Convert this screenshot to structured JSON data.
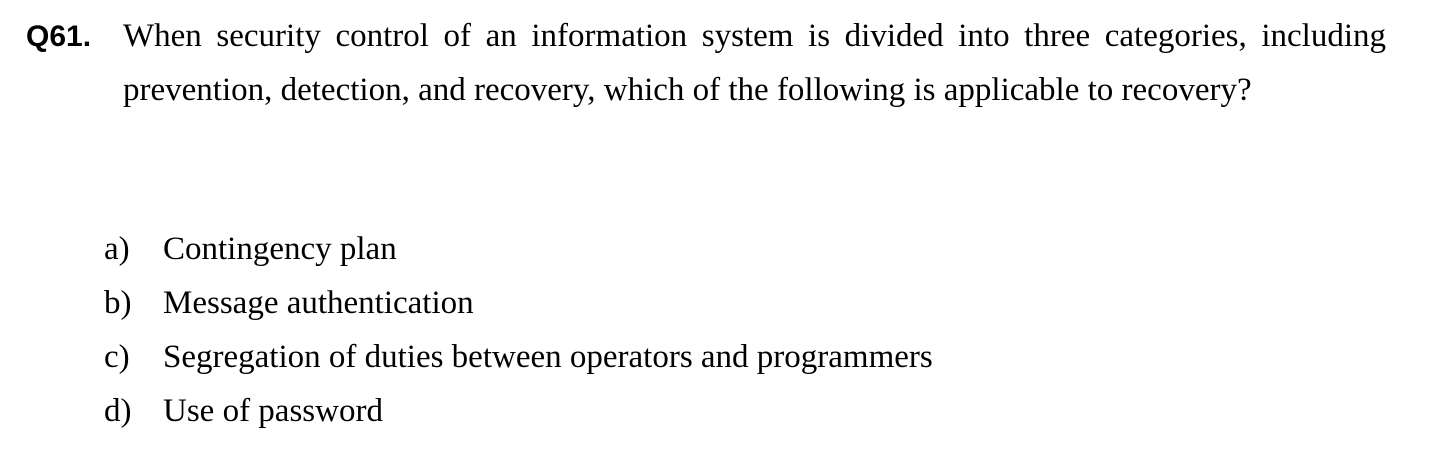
{
  "question": {
    "number": "Q61.",
    "text": "When security control of an information system is divided into three categories, including prevention, detection, and recovery, which of the following is applicable to recovery?"
  },
  "options": [
    {
      "letter": "a)",
      "text": "Contingency plan"
    },
    {
      "letter": "b)",
      "text": "Message authentication"
    },
    {
      "letter": "c)",
      "text": "Segregation of duties between operators and programmers"
    },
    {
      "letter": "d)",
      "text": "Use of password"
    }
  ]
}
